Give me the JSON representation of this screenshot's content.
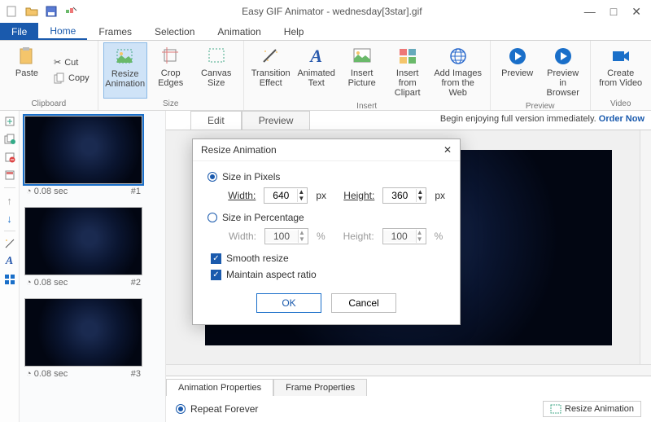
{
  "title": "Easy GIF Animator - wednesday[3star].gif",
  "menu": {
    "file": "File",
    "tabs": [
      "Home",
      "Frames",
      "Selection",
      "Animation",
      "Help"
    ],
    "active": 0
  },
  "ribbon": {
    "clipboard": {
      "caption": "Clipboard",
      "paste": "Paste",
      "cut": "Cut",
      "copy": "Copy"
    },
    "size": {
      "caption": "Size",
      "resize": "Resize\nAnimation",
      "crop": "Crop\nEdges",
      "canvas": "Canvas\nSize"
    },
    "insert": {
      "caption": "Insert",
      "transition": "Transition\nEffect",
      "animtext": "Animated\nText",
      "picture": "Insert\nPicture",
      "clipart": "Insert from\nClipart",
      "web": "Add Images\nfrom the Web"
    },
    "preview": {
      "caption": "Preview",
      "preview": "Preview",
      "browser": "Preview in\nBrowser"
    },
    "video": {
      "caption": "Video",
      "create": "Create\nfrom Video"
    }
  },
  "banner": {
    "text": "Begin enjoying full version immediately. ",
    "link": "Order Now"
  },
  "doctabs": {
    "edit": "Edit",
    "preview": "Preview"
  },
  "frames": [
    {
      "time": "0.08 sec",
      "idx": "#1",
      "selected": true
    },
    {
      "time": "0.08 sec",
      "idx": "#2",
      "selected": false
    },
    {
      "time": "0.08 sec",
      "idx": "#3",
      "selected": false
    }
  ],
  "props": {
    "tabs": {
      "anim": "Animation Properties",
      "frame": "Frame Properties"
    },
    "repeat": "Repeat Forever",
    "resizeBtn": "Resize Animation"
  },
  "dialog": {
    "title": "Resize Animation",
    "opt_px": "Size in Pixels",
    "opt_pct": "Size in Percentage",
    "width": "Width:",
    "height": "Height:",
    "wpx": "640",
    "hpx": "360",
    "wpct": "100",
    "hpct": "100",
    "unit_px": "px",
    "unit_pct": "%",
    "smooth": "Smooth resize",
    "aspect": "Maintain aspect ratio",
    "ok": "OK",
    "cancel": "Cancel"
  }
}
